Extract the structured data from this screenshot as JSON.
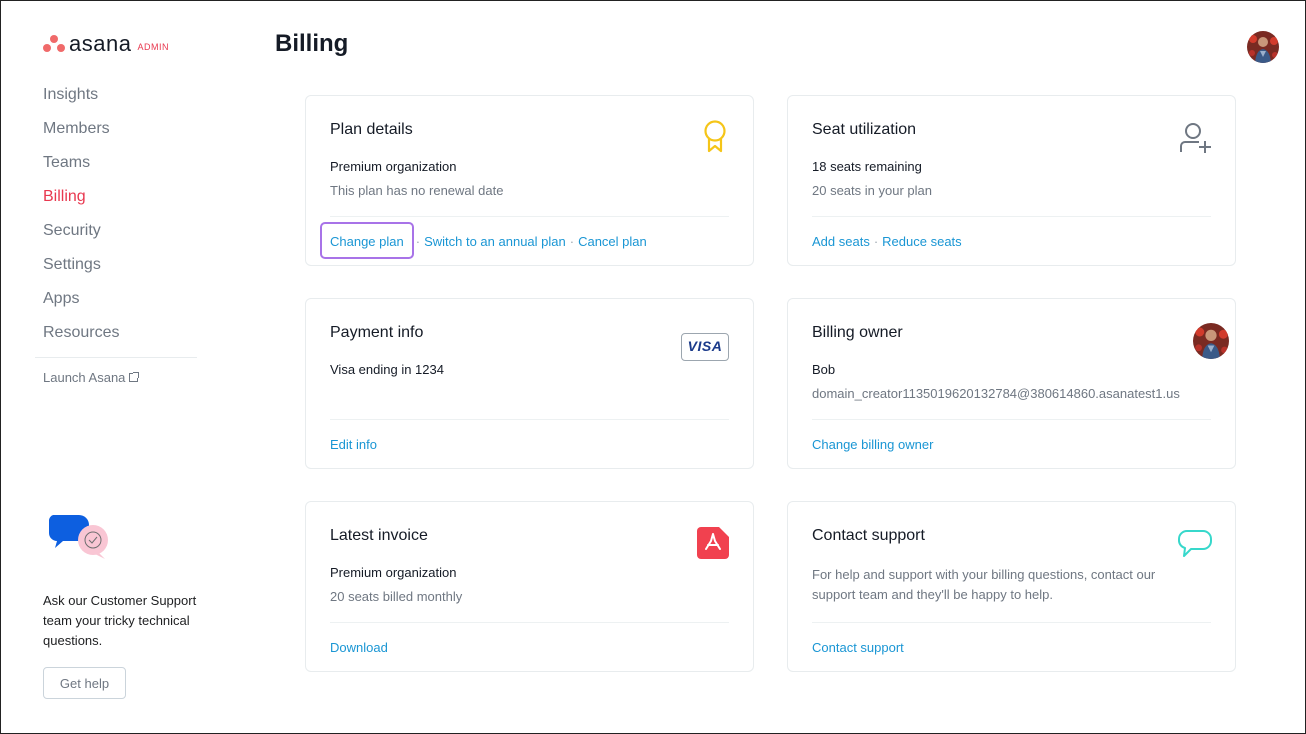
{
  "brand": {
    "name": "asana",
    "badge": "ADMIN",
    "accent": "#e8384f",
    "logo_color": "#f06a6a"
  },
  "sidebar": {
    "items": [
      {
        "label": "Insights",
        "active": false
      },
      {
        "label": "Members",
        "active": false
      },
      {
        "label": "Teams",
        "active": false
      },
      {
        "label": "Billing",
        "active": true
      },
      {
        "label": "Security",
        "active": false
      },
      {
        "label": "Settings",
        "active": false
      },
      {
        "label": "Apps",
        "active": false
      },
      {
        "label": "Resources",
        "active": false
      }
    ],
    "launch_label": "Launch Asana",
    "launch_icon": "external-link-icon",
    "support_text": "Ask our Customer Support team your tricky technical questions.",
    "get_help_label": "Get help"
  },
  "header": {
    "title": "Billing",
    "avatar": "user-avatar"
  },
  "link_color": "#1a96d4",
  "cards": {
    "plan": {
      "title": "Plan details",
      "icon": "award-ribbon-icon",
      "primary": "Premium organization",
      "secondary": "This plan has no renewal date",
      "links": [
        "Change plan",
        "Switch to an annual plan",
        "Cancel plan"
      ]
    },
    "seats": {
      "title": "Seat utilization",
      "icon": "add-user-icon",
      "primary": "18 seats remaining",
      "secondary": "20 seats in your plan",
      "links": [
        "Add seats",
        "Reduce seats"
      ]
    },
    "payment": {
      "title": "Payment info",
      "icon": "visa-card-icon",
      "icon_text": "VISA",
      "primary": "Visa ending in 1234",
      "links": [
        "Edit info"
      ]
    },
    "owner": {
      "title": "Billing owner",
      "icon": "owner-avatar",
      "primary": "Bob",
      "secondary": "domain_creator1135019620132784@380614860.asanatest1.us",
      "links": [
        "Change billing owner"
      ]
    },
    "invoice": {
      "title": "Latest invoice",
      "icon": "pdf-icon",
      "primary": "Premium organization",
      "secondary": "20 seats billed monthly",
      "links": [
        "Download"
      ]
    },
    "support": {
      "title": "Contact support",
      "icon": "chat-bubble-icon",
      "description": "For help and support with your billing questions, contact our support team and they'll be happy to help.",
      "links": [
        "Contact support"
      ]
    }
  }
}
